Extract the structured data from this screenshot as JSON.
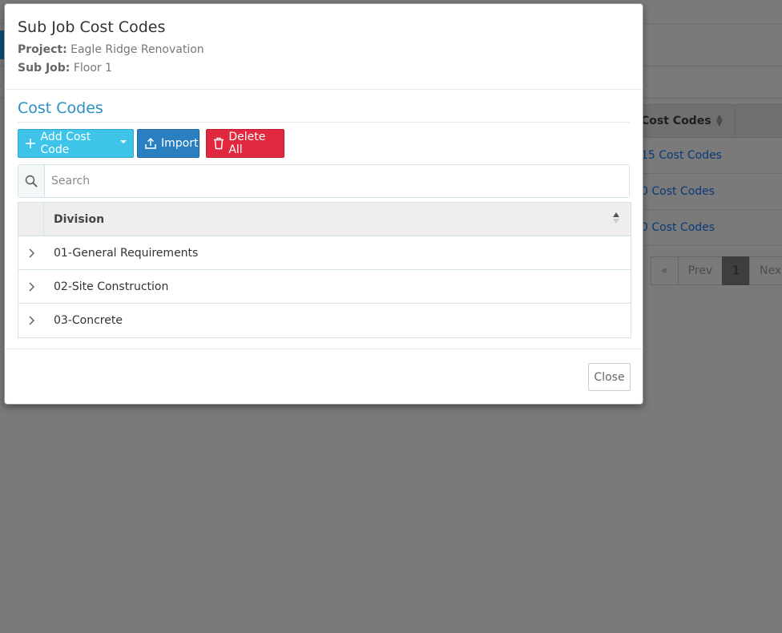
{
  "background": {
    "table": {
      "header_label": "Cost Codes",
      "rows": [
        "15 Cost Codes",
        "0 Cost Codes",
        "0 Cost Codes"
      ]
    },
    "pager": {
      "first": "«",
      "prev": "Prev",
      "current": "1",
      "next": "Next"
    }
  },
  "modal": {
    "title": "Sub Job Cost Codes",
    "project_label": "Project:",
    "project_value": "Eagle Ridge Renovation",
    "subjob_label": "Sub Job:",
    "subjob_value": "Floor 1",
    "section_title": "Cost Codes",
    "toolbar": {
      "add_label": "Add Cost Code",
      "import_label": "Import",
      "delete_all_label": "Delete All"
    },
    "search": {
      "placeholder": "Search",
      "value": ""
    },
    "grid": {
      "header": "Division",
      "rows": [
        "01-General Requirements",
        "02-Site Construction",
        "03-Concrete"
      ]
    },
    "footer": {
      "close_label": "Close"
    }
  },
  "colors": {
    "add_button": "#3dc4e8",
    "import_button": "#2a7fc0",
    "delete_button": "#e0293f",
    "section_title": "#2a8fc4",
    "overlay": "#7a7a7a"
  }
}
